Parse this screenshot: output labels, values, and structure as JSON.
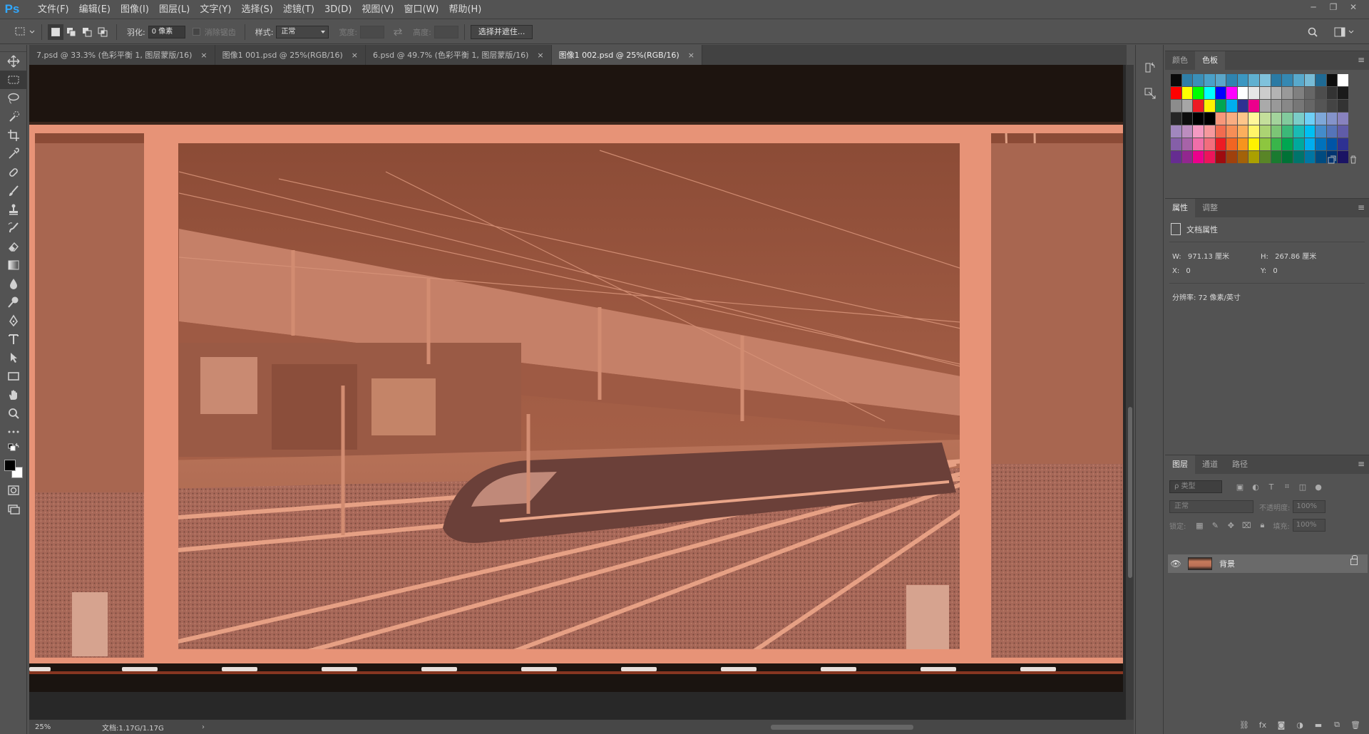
{
  "app": {
    "logo": "Ps"
  },
  "menu": [
    "文件(F)",
    "编辑(E)",
    "图像(I)",
    "图层(L)",
    "文字(Y)",
    "选择(S)",
    "滤镜(T)",
    "3D(D)",
    "视图(V)",
    "窗口(W)",
    "帮助(H)"
  ],
  "window_controls": {
    "minimize": "─",
    "restore": "❐",
    "close": "✕"
  },
  "options": {
    "feather_label": "羽化:",
    "feather_value": "0 像素",
    "antialias_label": "消除锯齿",
    "style_label": "样式:",
    "style_value": "正常",
    "width_label": "宽度:",
    "height_label": "高度:",
    "select_mask_button": "选择并遮住..."
  },
  "tabs": [
    {
      "label": "7.psd @ 33.3% (色彩平衡 1, 图层蒙版/16)",
      "close": "×"
    },
    {
      "label": "图像1 001.psd @ 25%(RGB/16)",
      "close": "×"
    },
    {
      "label": "6.psd @ 49.7% (色彩平衡 1, 图层蒙版/16)",
      "close": "×"
    },
    {
      "label": "图像1 002.psd @ 25%(RGB/16)",
      "close": "×"
    }
  ],
  "status": {
    "zoom": "25%",
    "doc_info": "文档:1.17G/1.17G",
    "arrow": "›"
  },
  "swatches_panel": {
    "tabs": [
      "颜色",
      "色板"
    ],
    "colors": [
      [
        "#0a0a0a",
        "#2f7fa8",
        "#3a8fb8",
        "#4aa0c8",
        "#5aa6c9",
        "#2f84b0",
        "#3b97c1",
        "#5fb0d0",
        "#80c2dc",
        "#2a7aa4",
        "#3488b2",
        "#58a9cc",
        "#77bbd6",
        "#1f6a94",
        "#0e0e0e",
        "#ffffff"
      ],
      [
        "#ff0000",
        "#ffff00",
        "#00ff00",
        "#00ffff",
        "#0000ff",
        "#ff00ff",
        "#ffffff",
        "#e6e6e6",
        "#cccccc",
        "#b3b3b3",
        "#999999",
        "#808080",
        "#666666",
        "#4d4d4d",
        "#333333",
        "#1a1a1a"
      ],
      [
        "#8c8c8c",
        "#a6a6a6",
        "#ed1c24",
        "#fff200",
        "#00a651",
        "#00aeef",
        "#2e3192",
        "#ec008c",
        "#aaaaaa",
        "#999999",
        "#888888",
        "#777777",
        "#666666",
        "#555555",
        "#444444",
        "#333333"
      ],
      [
        "#262626",
        "#0d0d0d",
        "#000000",
        "#000000",
        "#f7977a",
        "#f9ad81",
        "#fdc68a",
        "#fff79a",
        "#c4df9b",
        "#a3d39c",
        "#82ca9d",
        "#7bcdc8",
        "#6ecff6",
        "#7ea7d8",
        "#8493ca",
        "#8882be"
      ],
      [
        "#a187be",
        "#bc8dbf",
        "#f49ac2",
        "#f6989d",
        "#f26c4f",
        "#f68e56",
        "#fbaf5d",
        "#fff568",
        "#acd373",
        "#7cc576",
        "#3bb878",
        "#1abbb4",
        "#00bff3",
        "#438ccb",
        "#5574b9",
        "#605ca8"
      ],
      [
        "#855fa8",
        "#a763a8",
        "#f06ea9",
        "#f26d7d",
        "#ed1c24",
        "#f26522",
        "#f7941d",
        "#fff200",
        "#8dc63f",
        "#39b54a",
        "#00a651",
        "#00a99d",
        "#00aeef",
        "#0072bc",
        "#0054a6",
        "#2e3192"
      ],
      [
        "#662d91",
        "#92278f",
        "#ec008c",
        "#ed145b",
        "#9e0b0f",
        "#a0410d",
        "#a36209",
        "#aba000",
        "#598527",
        "#1a7b30",
        "#007236",
        "#00746b",
        "#0076a3",
        "#004b80",
        "#003471",
        "#1b1464"
      ]
    ]
  },
  "properties_panel": {
    "tabs": [
      "属性",
      "调整"
    ],
    "title": "文档属性",
    "w_label": "W:",
    "w_value": "971.13 厘米",
    "h_label": "H:",
    "h_value": "267.86 厘米",
    "x_label": "X:",
    "x_value": "0",
    "y_label": "Y:",
    "y_value": "0",
    "resolution": "分辨率: 72 像素/英寸"
  },
  "layers_panel": {
    "tabs": [
      "图层",
      "通道",
      "路径"
    ],
    "filter_placeholder": "ρ 类型",
    "blend_mode": "正常",
    "opacity_label": "不透明度:",
    "opacity_value": "100%",
    "lock_label": "锁定:",
    "fill_label": "填充:",
    "fill_value": "100%",
    "layer_name": "背景"
  }
}
